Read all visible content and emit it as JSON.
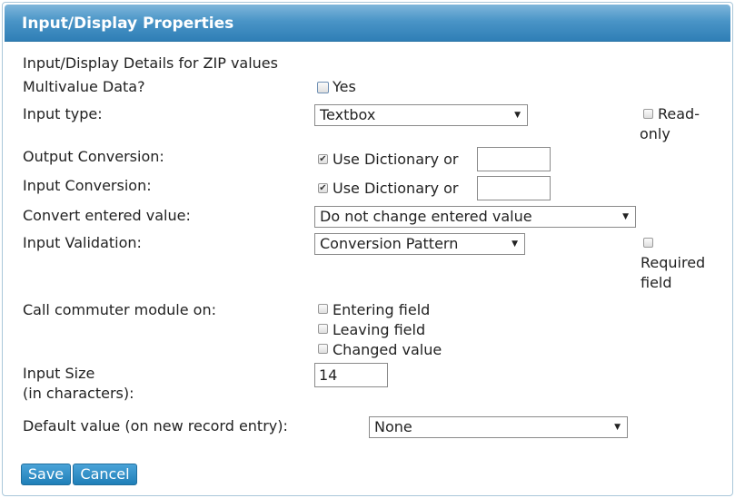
{
  "header": {
    "title": "Input/Display Properties"
  },
  "details_heading": "Input/Display Details for ZIP values",
  "multivalue": {
    "label": "Multivalue Data?",
    "option": "Yes",
    "checked": false
  },
  "input_type": {
    "label": "Input type:",
    "selected": "Textbox"
  },
  "read_only": {
    "line1": "Read-",
    "line2": "only",
    "checked": false
  },
  "output_conversion": {
    "label": "Output Conversion:",
    "option": "Use Dictionary or",
    "checked": true,
    "value": ""
  },
  "input_conversion": {
    "label": "Input Conversion:",
    "option": "Use Dictionary or",
    "checked": true,
    "value": ""
  },
  "convert_entered": {
    "label": "Convert entered value:",
    "selected": "Do not change entered value"
  },
  "input_validation": {
    "label": "Input Validation:",
    "selected": "Conversion Pattern"
  },
  "required_field": {
    "line1": "Required",
    "line2": "field",
    "checked": false
  },
  "commuter": {
    "label": "Call commuter module on:",
    "options": [
      {
        "label": "Entering field",
        "checked": false
      },
      {
        "label": "Leaving field",
        "checked": false
      },
      {
        "label": "Changed value",
        "checked": false
      }
    ]
  },
  "input_size": {
    "line1": "Input Size",
    "line2": "(in characters):",
    "value": "14"
  },
  "default_value": {
    "label": "Default value (on new record entry):",
    "selected": "None"
  },
  "buttons": {
    "save": "Save",
    "cancel": "Cancel"
  }
}
